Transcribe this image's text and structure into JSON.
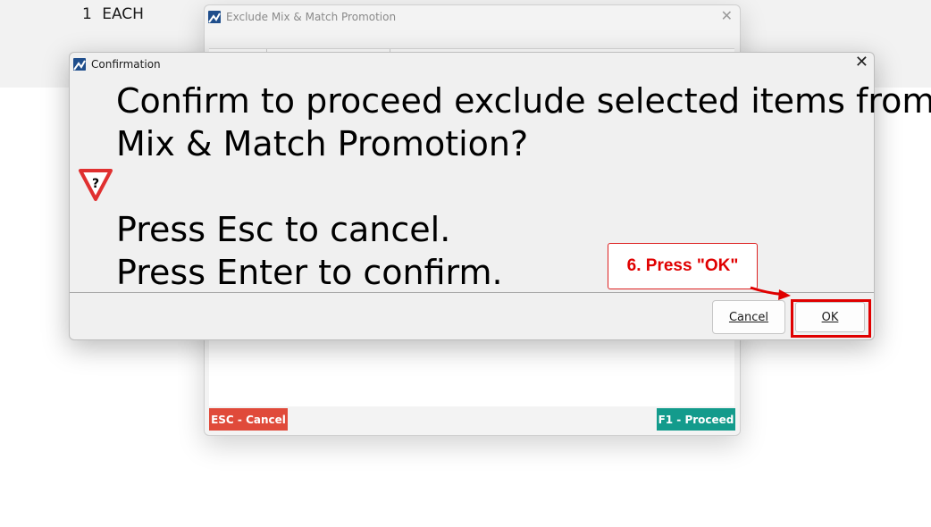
{
  "background": {
    "quantity": "1",
    "unit": "EACH"
  },
  "back_window": {
    "title": "Exclude Mix & Match Promotion",
    "esc_button": "ESC - Cancel",
    "proceed_button": "F1 - Proceed",
    "colors": {
      "esc": "#e04a3a",
      "proceed": "#139b8c"
    }
  },
  "dialog": {
    "title": "Confirmation",
    "message": "Confirm to proceed exclude selected items from\nMix & Match Promotion?\n\nPress Esc to cancel.\nPress Enter to confirm.",
    "icon": "warning-question-icon",
    "cancel_label": "Cancel",
    "ok_label": "OK"
  },
  "annotation": {
    "callout_text": "6. Press \"OK\"",
    "highlight_color": "#e00000"
  }
}
